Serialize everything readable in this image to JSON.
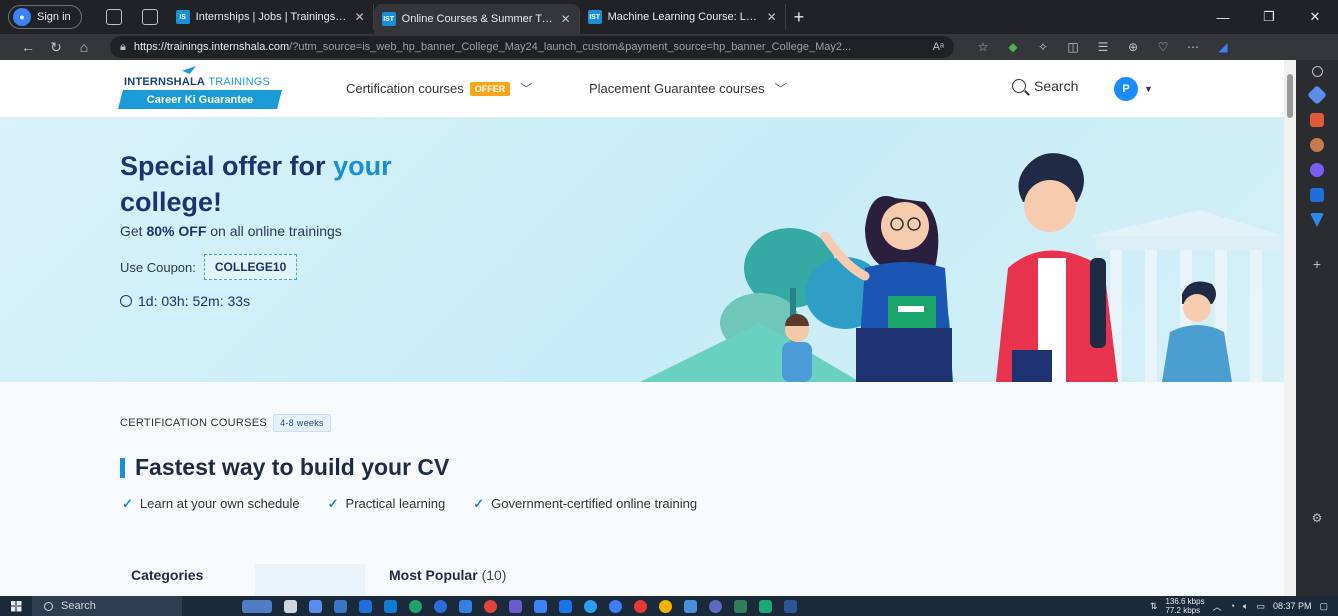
{
  "browser": {
    "signin_label": "Sign in",
    "tabs": [
      {
        "favicon": "IS",
        "title": "Internships | Jobs | Trainings & P",
        "color": "#1a8fd6"
      },
      {
        "favicon": "IST",
        "title": "Online Courses & Summer Traini",
        "color": "#1a8fd6"
      },
      {
        "favicon": "IST",
        "title": "Machine Learning Course: Learn",
        "color": "#1a8fd6"
      }
    ],
    "url_host": "https://trainings.internshala.com",
    "url_path": "/?utm_source=is_web_hp_banner_College_May24_launch_custom&payment_source=hp_banner_College_May2...",
    "read_aloud": "Aᵃ"
  },
  "header": {
    "logo_brand": "INTERNSHALA",
    "logo_brand_suffix": "TRAININGS",
    "logo_tagline": "Career Ki Guarantee",
    "nav": {
      "certification": "Certification courses",
      "offer_badge": "OFFER",
      "placement": "Placement Guarantee courses"
    },
    "search_label": "Search",
    "user_initial": "P"
  },
  "hero": {
    "title_part1": "Special offer for",
    "title_highlight": "your",
    "title_part2": "college!",
    "sub_prefix": "Get",
    "sub_bold": "80% OFF",
    "sub_suffix": "on all online trainings",
    "coupon_label": "Use Coupon:",
    "coupon_code": "COLLEGE10",
    "timer": "1d: 03h: 52m: 33s"
  },
  "courses": {
    "eyebrow": "CERTIFICATION COURSES",
    "duration_badge": "4-8 weeks",
    "title": "Fastest way to build your CV",
    "bullets": [
      "Learn at your own schedule",
      "Practical learning",
      "Government-certified online training"
    ],
    "categories_label": "Categories",
    "popular_label": "Most Popular",
    "popular_count": "(10)"
  },
  "taskbar": {
    "search_label": "Search",
    "net_up": "136.6 kbps",
    "net_down": "77.2 kbps",
    "time": "08:37 PM"
  },
  "colors": {
    "brand_blue": "#1a8fd6",
    "navy": "#1e3272",
    "offer_orange": "#f8a619"
  }
}
